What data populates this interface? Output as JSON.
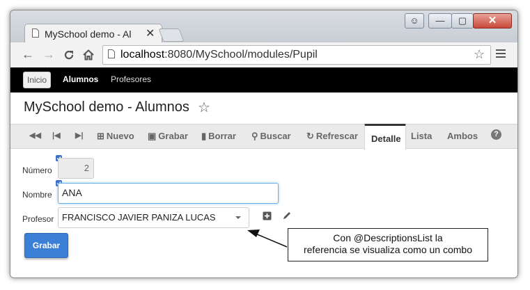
{
  "browser": {
    "tab_title": "MySchool demo - Al",
    "tab_close": "✕",
    "url_host": "localhost",
    "url_rest": ":8080/MySchool/modules/Pupil",
    "window_close": "✕",
    "window_min": "—",
    "window_max": "▢",
    "window_user": "☺"
  },
  "appnav": {
    "items": [
      {
        "label": "Inicio"
      },
      {
        "label": "Alumnos"
      },
      {
        "label": "Profesores"
      }
    ]
  },
  "page": {
    "title": "MySchool demo - Alumnos"
  },
  "toolbar": {
    "nuevo": "Nuevo",
    "grabar": "Grabar",
    "borrar": "Borrar",
    "buscar": "Buscar",
    "refrescar": "Refrescar",
    "detalle": "Detalle",
    "lista": "Lista",
    "ambos": "Ambos",
    "help": "?"
  },
  "form": {
    "numero_label": "Número",
    "numero_value": "2",
    "nombre_label": "Nombre",
    "nombre_value": "ANA",
    "profesor_label": "Profesor",
    "profesor_value": "FRANCISCO JAVIER PANIZA LUCAS",
    "grabar_button": "Grabar"
  },
  "annotation": {
    "line1": "Con @DescriptionsList la",
    "line2": "referencia se visualiza como un combo"
  },
  "colors": {
    "primary_button": "#3c7fd6",
    "nav_background": "#000000",
    "focus_border": "#66afe9"
  }
}
